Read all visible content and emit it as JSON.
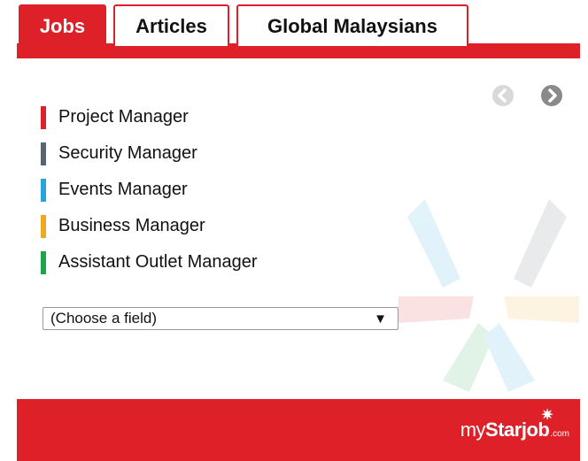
{
  "tabs": [
    {
      "label": "Jobs",
      "active": true
    },
    {
      "label": "Articles",
      "active": false
    },
    {
      "label": "Global Malaysians",
      "active": false
    }
  ],
  "pager": {
    "prev_icon": "chevron-left-icon",
    "next_icon": "chevron-right-icon"
  },
  "jobs": [
    {
      "title": "Project Manager",
      "color": "#de2129"
    },
    {
      "title": "Security Manager",
      "color": "#58646e"
    },
    {
      "title": "Events Manager",
      "color": "#29a3dc"
    },
    {
      "title": "Business Manager",
      "color": "#f0a722"
    },
    {
      "title": "Assistant Outlet Manager",
      "color": "#1ea64a"
    }
  ],
  "field_select": {
    "value": "(Choose a field)",
    "arrow": "▼"
  },
  "footer": {
    "brand_my": "my",
    "brand_star": "Starjob",
    "brand_suffix": ".com"
  },
  "colors": {
    "accent": "#de2129"
  }
}
